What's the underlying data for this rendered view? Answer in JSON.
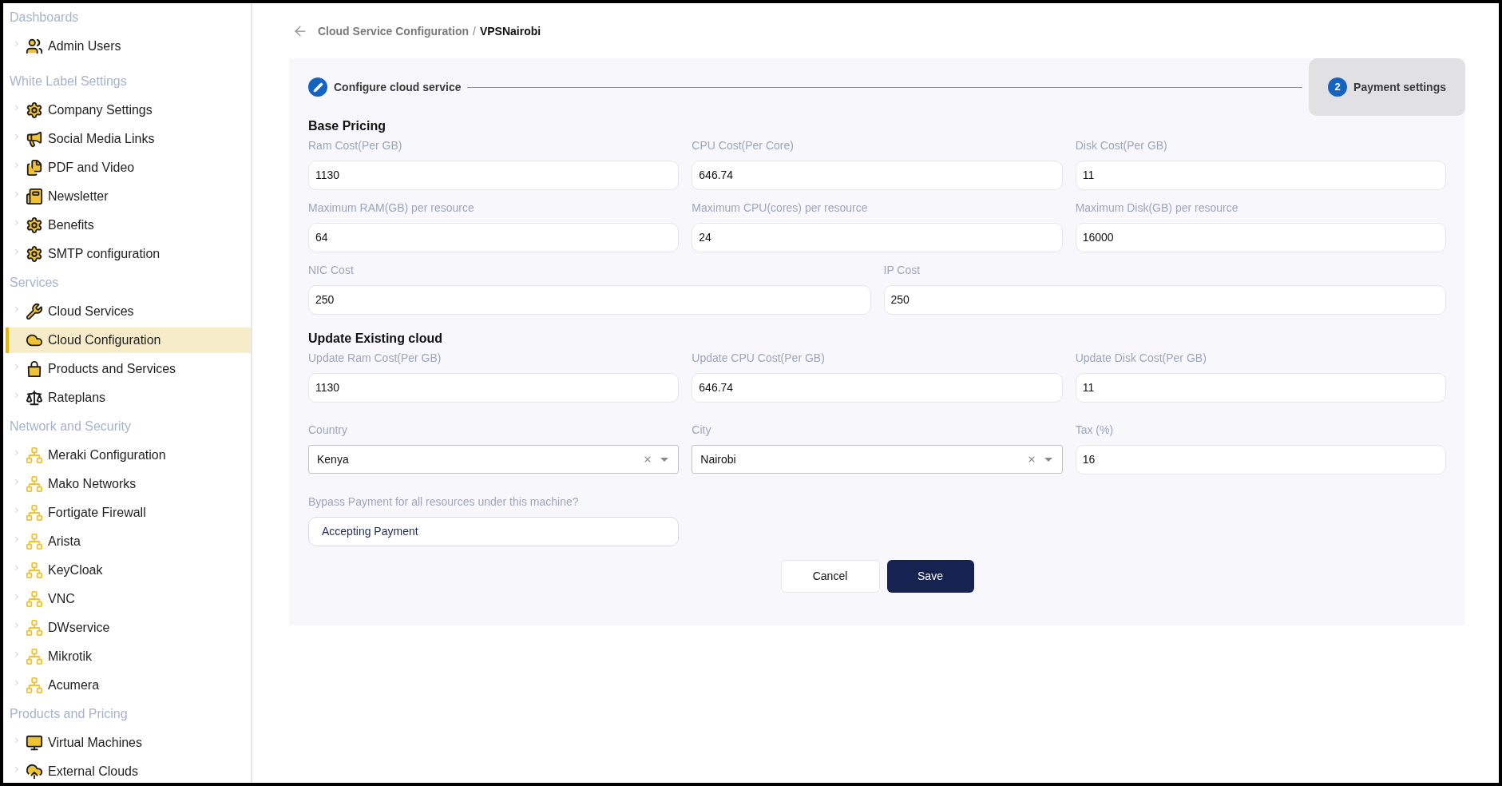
{
  "sidebar": {
    "sections": [
      {
        "title": "Dashboards",
        "items": [
          {
            "label": "Admin Users",
            "kind": "users",
            "selected": false
          }
        ]
      },
      {
        "title": "White Label Settings",
        "items": [
          {
            "label": "Company Settings",
            "kind": "gear",
            "selected": false
          },
          {
            "label": "Social Media Links",
            "kind": "megaphone",
            "selected": false
          },
          {
            "label": "PDF and Video",
            "kind": "documents",
            "selected": false
          },
          {
            "label": "Newsletter",
            "kind": "newspaper",
            "selected": false
          },
          {
            "label": "Benefits",
            "kind": "gear",
            "selected": false
          },
          {
            "label": "SMTP configuration",
            "kind": "gear",
            "selected": false
          }
        ]
      },
      {
        "title": "Services",
        "items": [
          {
            "label": "Cloud Services",
            "kind": "tools",
            "selected": false
          },
          {
            "label": "Cloud Configuration",
            "kind": "cloud",
            "selected": true
          },
          {
            "label": "Products and Services",
            "kind": "bag",
            "selected": false
          },
          {
            "label": "Rateplans",
            "kind": "scale",
            "selected": false
          }
        ]
      },
      {
        "title": "Network and Security",
        "items": [
          {
            "label": "Meraki Configuration",
            "kind": "network",
            "selected": false
          },
          {
            "label": "Mako Networks",
            "kind": "network",
            "selected": false
          },
          {
            "label": "Fortigate Firewall",
            "kind": "network",
            "selected": false
          },
          {
            "label": "Arista",
            "kind": "network",
            "selected": false
          },
          {
            "label": "KeyCloak",
            "kind": "network",
            "selected": false
          },
          {
            "label": "VNC",
            "kind": "network",
            "selected": false
          },
          {
            "label": "DWservice",
            "kind": "network",
            "selected": false
          },
          {
            "label": "Mikrotik",
            "kind": "network",
            "selected": false
          },
          {
            "label": "Acumera",
            "kind": "network",
            "selected": false
          }
        ]
      },
      {
        "title": "Products and Pricing",
        "items": [
          {
            "label": "Virtual Machines",
            "kind": "monitor",
            "selected": false
          },
          {
            "label": "External Clouds",
            "kind": "upload",
            "selected": false
          }
        ]
      }
    ]
  },
  "breadcrumb": {
    "parent": "Cloud Service Configuration",
    "separator": "/",
    "current": "VPSNairobi"
  },
  "stepper": {
    "steps": [
      {
        "kind": "edit",
        "label": "Configure cloud service",
        "selected": false
      },
      {
        "kind": "number",
        "number": "2",
        "label": "Payment settings",
        "selected": true
      }
    ]
  },
  "form": {
    "sections": [
      {
        "title": "Base Pricing",
        "rows": [
          [
            {
              "label": "Ram Cost(Per GB)",
              "value": "1130",
              "kind": "input"
            },
            {
              "label": "CPU Cost(Per Core)",
              "value": "646.74",
              "kind": "input"
            },
            {
              "label": "Disk Cost(Per GB)",
              "value": "11",
              "kind": "input"
            }
          ],
          [
            {
              "label": "Maximum RAM(GB) per resource",
              "value": "64",
              "kind": "input"
            },
            {
              "label": "Maximum CPU(cores) per resource",
              "value": "24",
              "kind": "input"
            },
            {
              "label": "Maximum Disk(GB) per resource",
              "value": "16000",
              "kind": "input"
            }
          ],
          [
            {
              "label": "NIC Cost",
              "value": "250",
              "kind": "input"
            },
            {
              "label": "IP Cost",
              "value": "250",
              "kind": "input"
            }
          ]
        ]
      },
      {
        "title": "Update Existing cloud",
        "rows": [
          [
            {
              "label": "Update Ram Cost(Per GB)",
              "value": "1130",
              "kind": "input"
            },
            {
              "label": "Update CPU Cost(Per GB)",
              "value": "646.74",
              "kind": "input"
            },
            {
              "label": "Update Disk Cost(Per GB)",
              "value": "11",
              "kind": "input"
            }
          ],
          [
            {
              "label": "Country",
              "value": "Kenya",
              "kind": "select"
            },
            {
              "label": "City",
              "value": "Nairobi",
              "kind": "select"
            },
            {
              "label": "Tax (%)",
              "value": "16",
              "kind": "input"
            }
          ],
          [
            {
              "label": "Bypass Payment for all resources under this machine?",
              "value": "Accepting Payment",
              "kind": "choice"
            }
          ]
        ]
      }
    ],
    "buttons": [
      {
        "label": "Cancel",
        "kind": "secondary"
      },
      {
        "label": "Save",
        "kind": "primary"
      }
    ]
  }
}
